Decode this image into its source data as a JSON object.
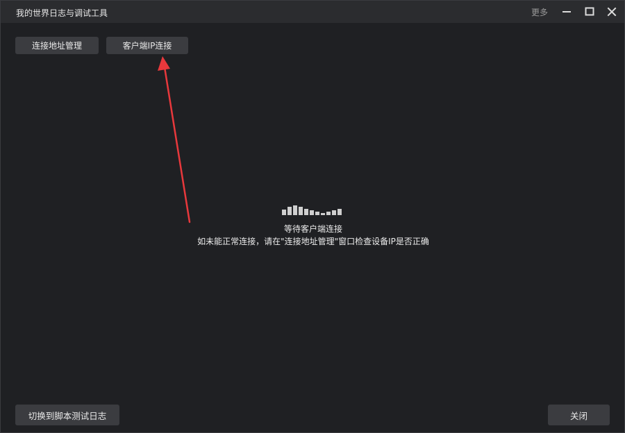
{
  "window": {
    "title": "我的世界日志与调试工具",
    "more_label": "更多"
  },
  "toolbar": {
    "address_manage_label": "连接地址管理",
    "client_ip_label": "客户端IP连接"
  },
  "status": {
    "waiting_text": "等待客户端连接",
    "hint_text": "如未能正常连接，请在\"连接地址管理\"窗口检查设备IP是否正确"
  },
  "footer": {
    "switch_label": "切换到脚本测试日志",
    "close_label": "关闭"
  },
  "colors": {
    "background": "#1f2023",
    "titlebar": "#2b2c2f",
    "button": "#3b3c40",
    "arrow": "#e8383c",
    "loader": "#cfcfcf"
  },
  "icons": [
    "minimize-icon",
    "maximize-icon",
    "close-icon",
    "loading-bars-icon",
    "annotation-arrow"
  ]
}
